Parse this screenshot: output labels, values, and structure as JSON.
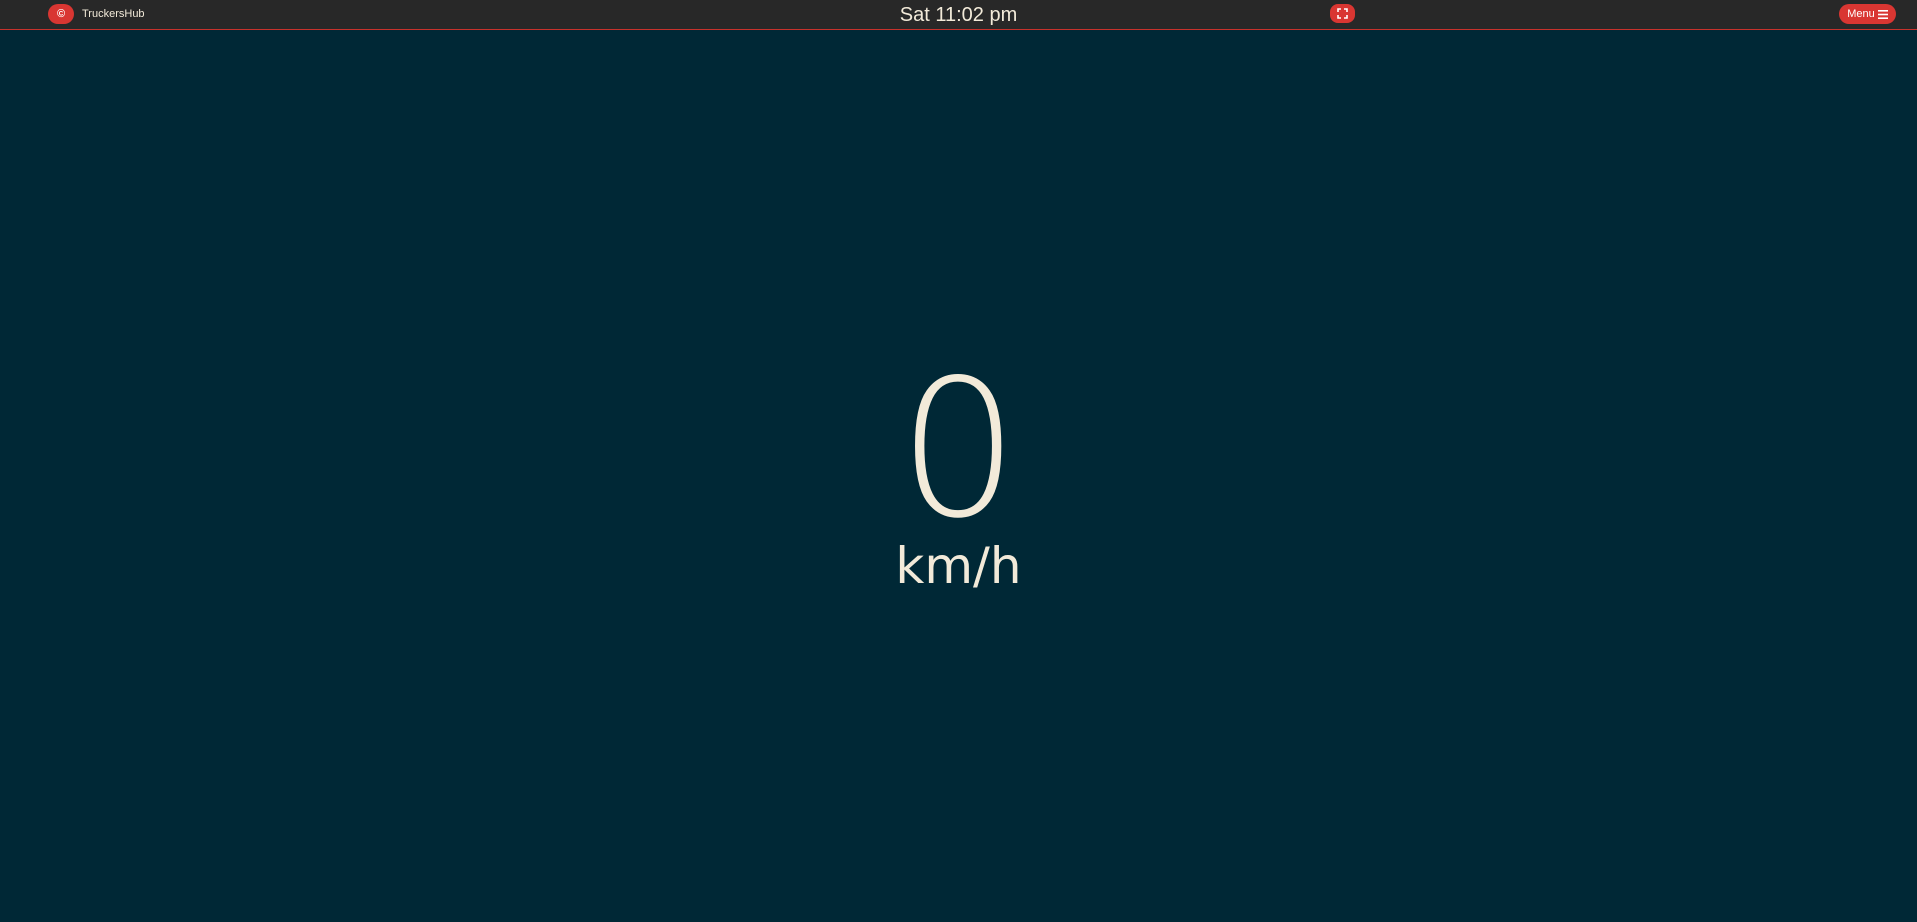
{
  "header": {
    "logo_glyph": "©",
    "brand": "TruckersHub",
    "clock": "Sat 11:02 pm",
    "fullscreen_icon": "fullscreen-icon",
    "menu_label": "Menu",
    "menu_icon": "hamburger-icon"
  },
  "dashboard": {
    "speed": "0",
    "unit": "km/h"
  },
  "colors": {
    "background": "#002836",
    "topbar": "#282828",
    "accent": "#d93632",
    "text": "#f2ead9"
  }
}
